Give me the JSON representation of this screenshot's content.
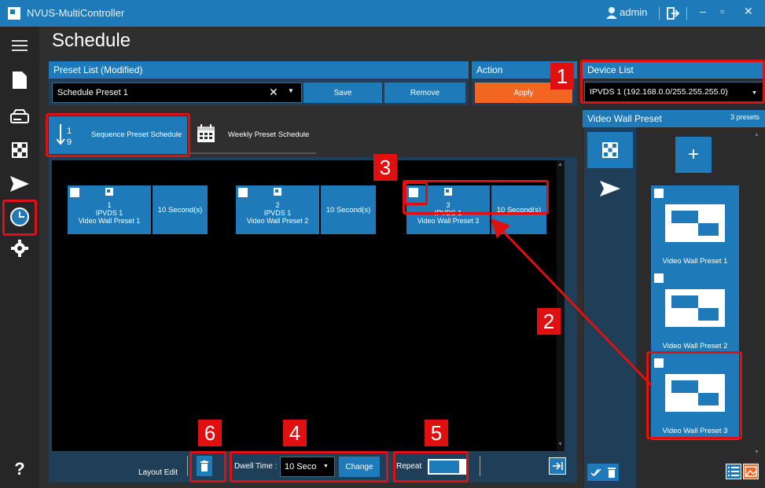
{
  "window": {
    "title": "NVUS-MultiController",
    "user": "admin",
    "min_glyph": "–",
    "max_glyph": "▫",
    "close_glyph": "✕"
  },
  "page": {
    "title": "Schedule"
  },
  "nav": {
    "help_glyph": "?"
  },
  "preset_list": {
    "header": "Preset List (Modified)",
    "value": "Schedule Preset 1",
    "clear_glyph": "✕",
    "save_label": "Save",
    "remove_label": "Remove"
  },
  "action": {
    "header": "Action",
    "apply_label": "Apply"
  },
  "device_list": {
    "header": "Device List",
    "value": "IPVDS 1 (192.168.0.0/255.255.255.0)"
  },
  "tabs": {
    "sequence": "Sequence Preset Schedule",
    "weekly": "Weekly Preset Schedule"
  },
  "sequence": [
    {
      "index": "1",
      "device": "IPVDS 1",
      "preset": "Video Wall Preset 1",
      "dwell": "10 Second(s)"
    },
    {
      "index": "2",
      "device": "IPVDS 1",
      "preset": "Video Wall Preset 2",
      "dwell": "10 Second(s)"
    },
    {
      "index": "3",
      "device": "IPVDS 1",
      "preset": "Video Wall Preset 3",
      "dwell": "10 Second(s)"
    }
  ],
  "bottom_bar": {
    "layout_edit": "Layout Edit",
    "dwell_label": "Dwell Time :",
    "dwell_value": "10 Seco",
    "change_label": "Change",
    "repeat_label": "Repeat"
  },
  "video_wall": {
    "header": "Video Wall Preset",
    "count": "3 presets",
    "add_glyph": "+",
    "presets": [
      "Video Wall Preset 1",
      "Video Wall Preset 2",
      "Video Wall Preset 3"
    ]
  },
  "annotations": [
    "1",
    "2",
    "3",
    "4",
    "5",
    "6"
  ],
  "colors": {
    "accent": "#1e7ab8",
    "apply": "#f26522",
    "highlight": "#e01010",
    "panel": "#1e3f57"
  }
}
